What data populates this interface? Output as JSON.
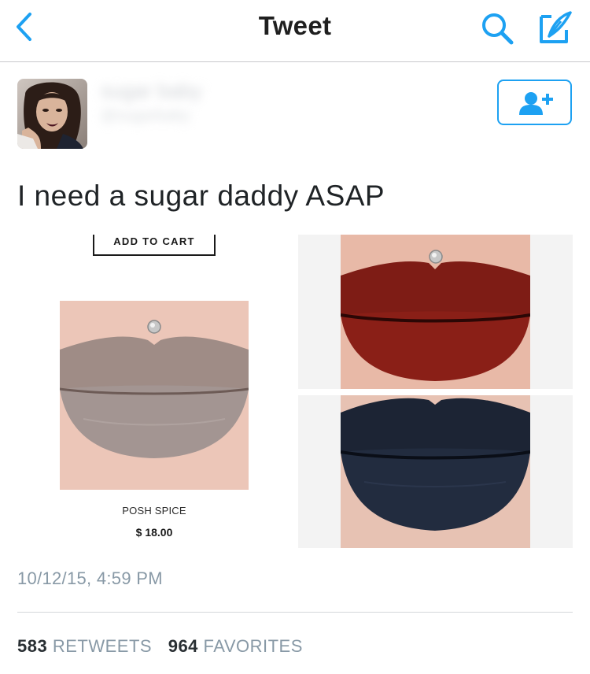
{
  "colors": {
    "accent": "#1da1f2",
    "muted": "#8899a6",
    "text": "#1f2326"
  },
  "navbar": {
    "title": "Tweet",
    "back_icon": "chevron-left-icon",
    "search_icon": "search-icon",
    "compose_icon": "compose-quill-icon"
  },
  "author": {
    "name": "sugar baby",
    "handle": "@sugarbaby",
    "follow_icon": "add-user-icon"
  },
  "tweet": {
    "text": "I need a sugar daddy ASAP",
    "timestamp": "10/12/15, 4:59 PM"
  },
  "media": {
    "left": {
      "add_to_cart_label": "ADD TO CART",
      "product_name": "POSH SPICE",
      "product_price": "$ 18.00"
    }
  },
  "stats": {
    "retweets_count": "583",
    "retweets_label": "RETWEETS",
    "favorites_count": "964",
    "favorites_label": "FAVORITES"
  }
}
